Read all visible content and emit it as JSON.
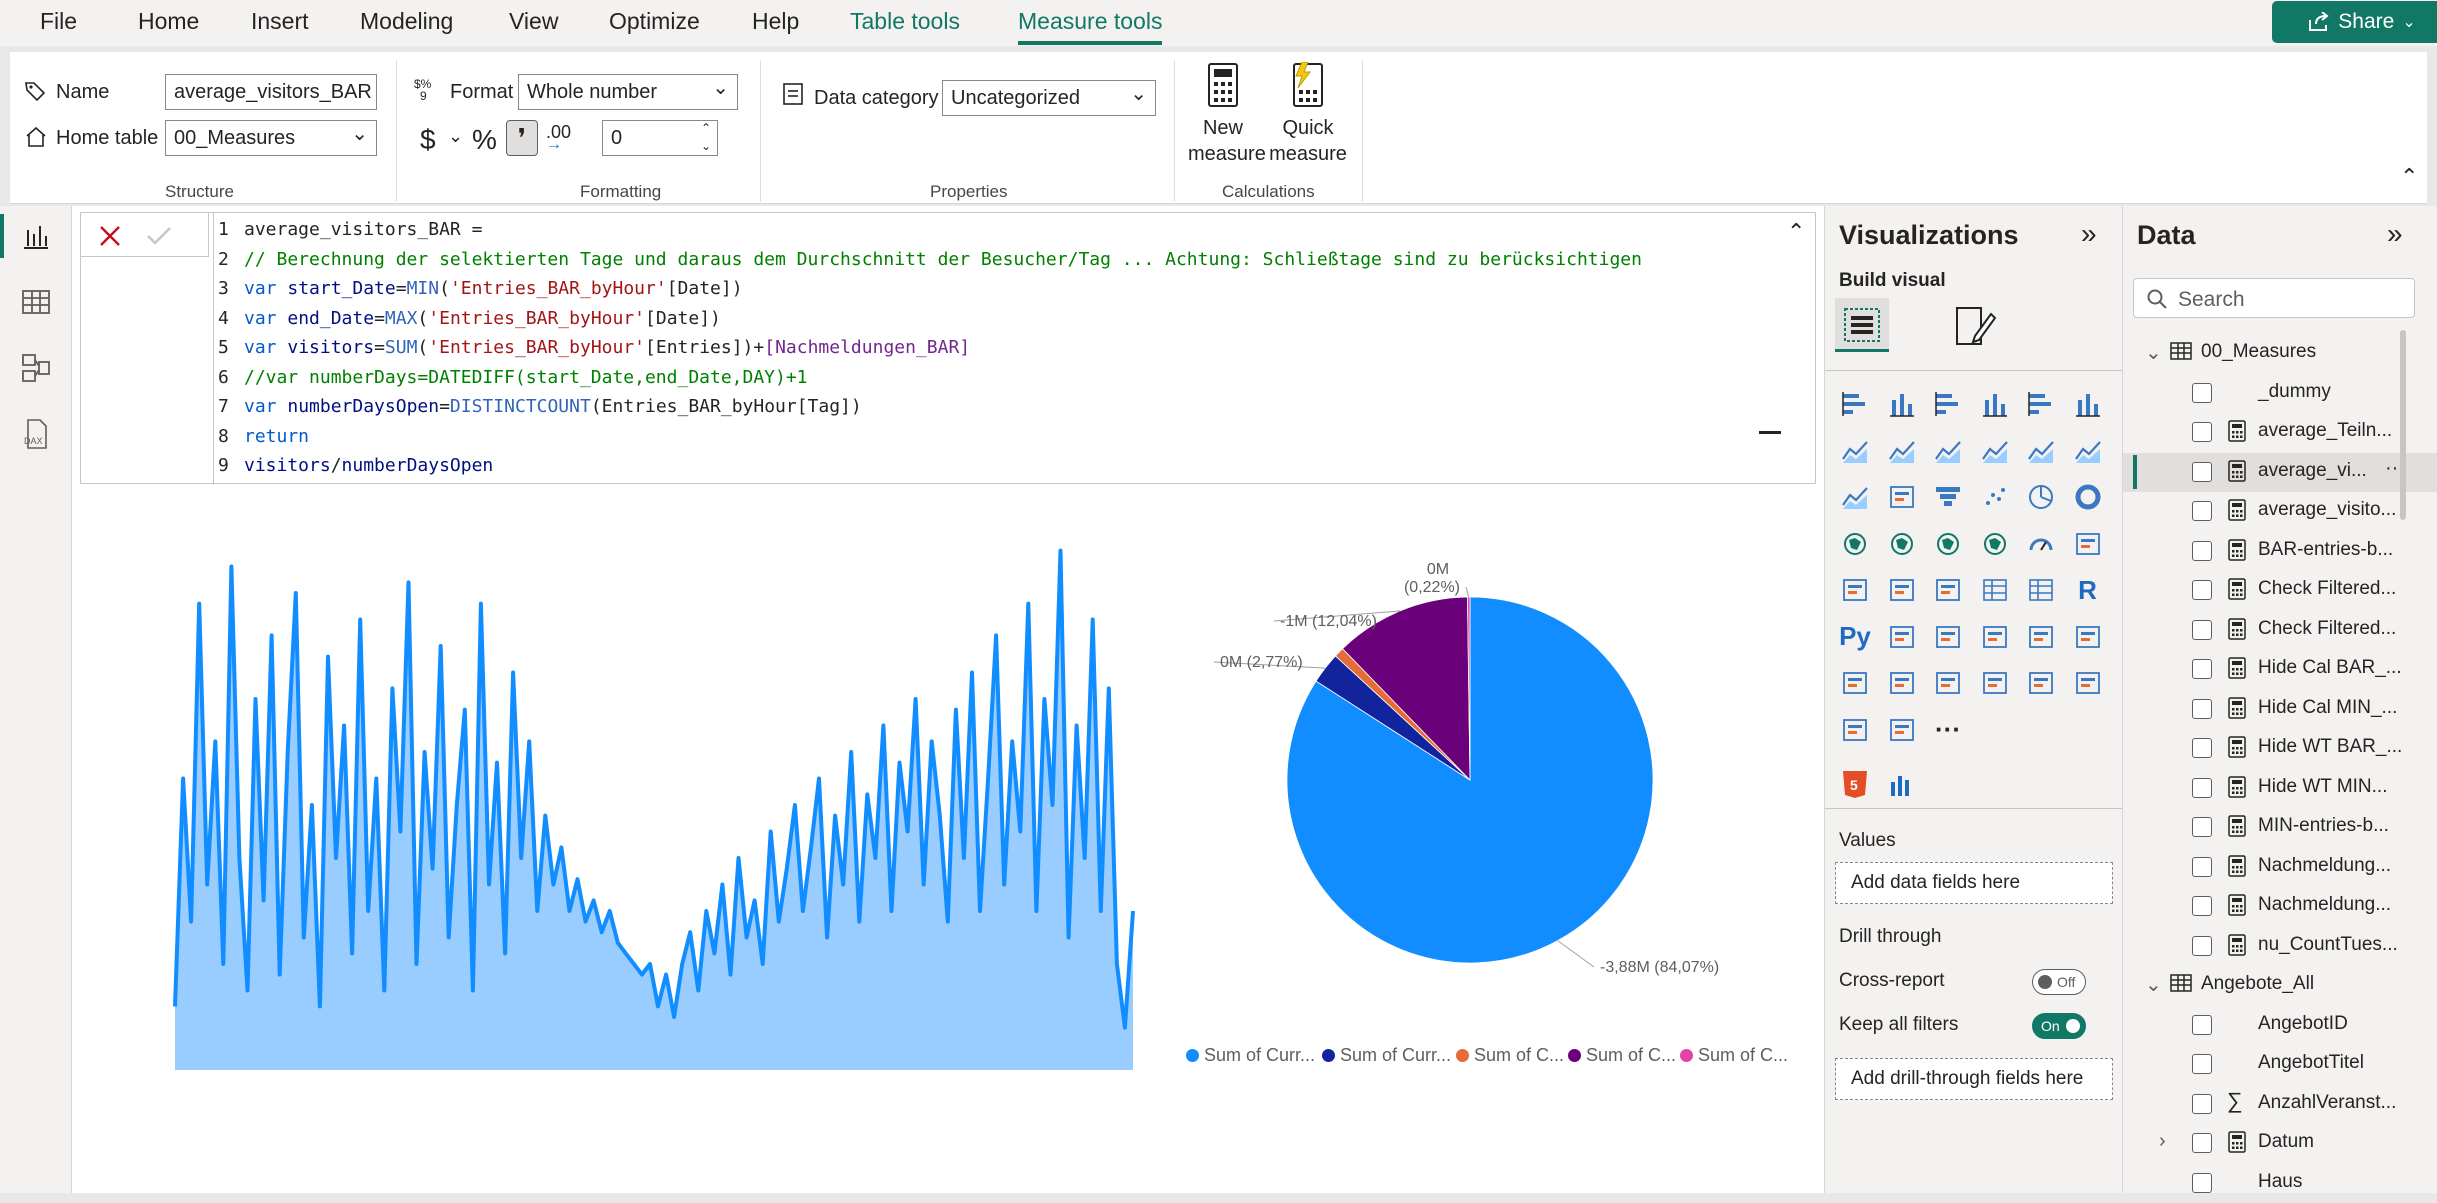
{
  "menu": {
    "items": [
      "File",
      "Home",
      "Insert",
      "Modeling",
      "View",
      "Optimize",
      "Help",
      "Table tools",
      "Measure tools"
    ],
    "share_label": "Share"
  },
  "ribbon": {
    "structure": {
      "name_label": "Name",
      "name_value": "average_visitors_BAR",
      "home_table_label": "Home table",
      "home_table_value": "00_Measures",
      "group_label": "Structure"
    },
    "formatting": {
      "format_label": "Format",
      "format_value": "Whole number",
      "currency_symbol": "$",
      "percent_symbol": "%",
      "comma_symbol": "❜",
      "decimal_symbol": ".00",
      "decimals_value": "0",
      "group_label": "Formatting"
    },
    "properties": {
      "data_category_label": "Data category",
      "data_category_value": "Uncategorized",
      "group_label": "Properties"
    },
    "calculations": {
      "new_measure_line1": "New",
      "new_measure_line2": "measure",
      "quick_measure_line1": "Quick",
      "quick_measure_line2": "measure",
      "group_label": "Calculations"
    }
  },
  "formula": {
    "lines": [
      {
        "n": "1",
        "tokens": [
          [
            "def",
            "average_visitors_BAR ="
          ]
        ]
      },
      {
        "n": "2",
        "tokens": [
          [
            "cm",
            "// Berechnung der selektierten Tage und daraus dem Durchschnitt der Besucher/Tag ... Achtung: Schließtage sind zu berücksichtigen"
          ]
        ]
      },
      {
        "n": "3",
        "tokens": [
          [
            "kw",
            "var "
          ],
          [
            "var",
            "start_Date"
          ],
          [
            "def",
            "="
          ],
          [
            "fn",
            "MIN"
          ],
          [
            "def",
            "("
          ],
          [
            "st",
            "'Entries_BAR_byHour'"
          ],
          [
            "def",
            "[Date])"
          ]
        ]
      },
      {
        "n": "4",
        "tokens": [
          [
            "kw",
            "var "
          ],
          [
            "var",
            "end_Date"
          ],
          [
            "def",
            "="
          ],
          [
            "fn",
            "MAX"
          ],
          [
            "def",
            "("
          ],
          [
            "st",
            "'Entries_BAR_byHour'"
          ],
          [
            "def",
            "[Date])"
          ]
        ]
      },
      {
        "n": "5",
        "tokens": [
          [
            "kw",
            "var "
          ],
          [
            "var",
            "visitors"
          ],
          [
            "def",
            "="
          ],
          [
            "fn",
            "SUM"
          ],
          [
            "def",
            "("
          ],
          [
            "st",
            "'Entries_BAR_byHour'"
          ],
          [
            "def",
            "[Entries])+"
          ],
          [
            "ref",
            "[Nachmeldungen_BAR]"
          ]
        ]
      },
      {
        "n": "6",
        "tokens": [
          [
            "cm",
            "//var numberDays=DATEDIFF(start_Date,end_Date,DAY)+1"
          ]
        ]
      },
      {
        "n": "7",
        "tokens": [
          [
            "kw",
            "var "
          ],
          [
            "var",
            "numberDaysOpen"
          ],
          [
            "def",
            "="
          ],
          [
            "fn",
            "DISTINCTCOUNT"
          ],
          [
            "def",
            "(Entries_BAR_byHour[Tag])"
          ]
        ]
      },
      {
        "n": "8",
        "tokens": [
          [
            "kw",
            "return"
          ]
        ]
      },
      {
        "n": "9",
        "tokens": [
          [
            "var",
            "visitors"
          ],
          [
            "def",
            "/"
          ],
          [
            "var",
            "numberDaysOpen"
          ]
        ]
      }
    ]
  },
  "area_chart": {
    "series_color": "#118dff",
    "fill_color": "#99cdff",
    "values": [
      0.12,
      0.55,
      0.28,
      0.88,
      0.35,
      0.62,
      0.2,
      0.95,
      0.4,
      0.15,
      0.7,
      0.32,
      0.82,
      0.18,
      0.6,
      0.9,
      0.25,
      0.5,
      0.12,
      0.78,
      0.4,
      0.65,
      0.22,
      0.85,
      0.3,
      0.55,
      0.15,
      0.72,
      0.45,
      0.92,
      0.2,
      0.6,
      0.38,
      0.8,
      0.25,
      0.5,
      0.68,
      0.15,
      0.88,
      0.35,
      0.58,
      0.22,
      0.75,
      0.4,
      0.62,
      0.3,
      0.48,
      0.35,
      0.42,
      0.3,
      0.36,
      0.28,
      0.32,
      0.26,
      0.3,
      0.24,
      0.22,
      0.2,
      0.18,
      0.2,
      0.12,
      0.18,
      0.1,
      0.2,
      0.26,
      0.15,
      0.3,
      0.22,
      0.35,
      0.18,
      0.4,
      0.25,
      0.32,
      0.2,
      0.45,
      0.28,
      0.38,
      0.5,
      0.3,
      0.42,
      0.55,
      0.25,
      0.48,
      0.35,
      0.6,
      0.28,
      0.52,
      0.4,
      0.65,
      0.3,
      0.58,
      0.45,
      0.7,
      0.35,
      0.62,
      0.48,
      0.28,
      0.68,
      0.4,
      0.75,
      0.3,
      0.55,
      0.82,
      0.35,
      0.62,
      0.45,
      0.88,
      0.3,
      0.7,
      0.5,
      0.98,
      0.25,
      0.65,
      0.4,
      0.85,
      0.3,
      0.72,
      0.2,
      0.08,
      0.3
    ]
  },
  "chart_data": {
    "type": "pie",
    "slices": [
      {
        "label": "-3,88M (84,07%)",
        "value": 84.07,
        "color": "#118dff"
      },
      {
        "label": "0M (2,77%)",
        "value": 2.77,
        "color": "#12239e"
      },
      {
        "label": "",
        "value": 0.88,
        "color": "#e66c37"
      },
      {
        "label": "-1M (12,04%)",
        "value": 12.04,
        "color": "#6b007b"
      },
      {
        "label": "0M (0,22%)",
        "value": 0.22,
        "color": "#e044a7"
      }
    ],
    "legend": [
      {
        "name": "Sum of Curr...",
        "color": "#118dff"
      },
      {
        "name": "Sum of Curr...",
        "color": "#12239e"
      },
      {
        "name": "Sum of C...",
        "color": "#e66c37"
      },
      {
        "name": "Sum of C...",
        "color": "#6b007b"
      },
      {
        "name": "Sum of C...",
        "color": "#e044a7"
      }
    ],
    "legend_placement": "bottom"
  },
  "visualizations": {
    "title": "Visualizations",
    "build_visual_label": "Build visual",
    "values_label": "Values",
    "add_data_fields": "Add data fields here",
    "drill_through_label": "Drill through",
    "cross_report_label": "Cross-report",
    "cross_report_state": "Off",
    "keep_filters_label": "Keep all filters",
    "keep_filters_state": "On",
    "add_drill_fields": "Add drill-through fields here",
    "r_label": "R",
    "py_label": "Py",
    "more_label": "···"
  },
  "data_pane": {
    "title": "Data",
    "search_placeholder": "Search",
    "more_label": "···",
    "tables": [
      {
        "name": "00_Measures",
        "fields": [
          "_dummy",
          "average_Teiln...",
          "average_vi...",
          "average_visito...",
          "BAR-entries-b...",
          "Check Filtered...",
          "Check Filtered...",
          "Hide Cal BAR_...",
          "Hide Cal MIN_...",
          "Hide WT BAR_...",
          "Hide WT MIN...",
          "MIN-entries-b...",
          "Nachmeldung...",
          "Nachmeldung...",
          "nu_CountTues..."
        ]
      },
      {
        "name": "Angebote_All",
        "fields": [
          "AngebotID",
          "AngebotTitel",
          "AnzahlVeranst...",
          "Datum",
          "Haus"
        ]
      }
    ]
  },
  "colors": {
    "accent": "#117865",
    "selection_bar": "#117865"
  }
}
